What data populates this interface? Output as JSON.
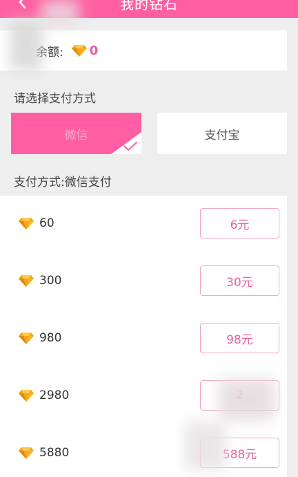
{
  "header": {
    "title": "我的钻石",
    "back_icon": "chevron-left-icon"
  },
  "balance": {
    "label": "余额:",
    "value": "0",
    "icon": "diamond-icon"
  },
  "payment_section": {
    "title": "请选择支付方式",
    "options": [
      {
        "label": "微信",
        "selected": true
      },
      {
        "label": "支付宝",
        "selected": false
      }
    ]
  },
  "selected_method": "支付方式:微信支付",
  "packages": [
    {
      "amount": "60",
      "price": "6元"
    },
    {
      "amount": "300",
      "price": "30元"
    },
    {
      "amount": "980",
      "price": "98元"
    },
    {
      "amount": "2980",
      "price": "2"
    },
    {
      "amount": "5880",
      "price": "588元"
    }
  ],
  "colors": {
    "accent": "#ff5fa2",
    "price_text": "#ee5d9e",
    "diamond": "#f0a418"
  }
}
